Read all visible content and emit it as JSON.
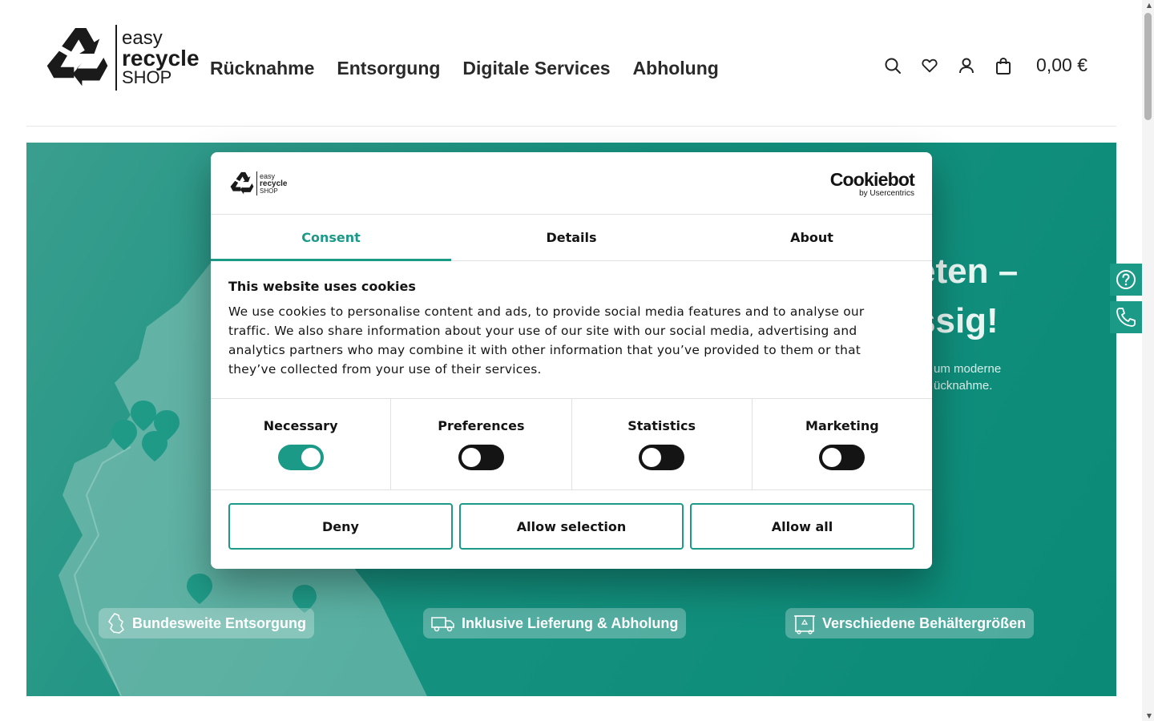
{
  "brand": {
    "line1": "easy",
    "line2": "recycle",
    "line3": "SHOP"
  },
  "nav": {
    "items": [
      "Rücknahme",
      "Entsorgung",
      "Digitale Services",
      "Abholung"
    ]
  },
  "header_tools": {
    "cart_total": "0,00 €",
    "icons": [
      "search-icon",
      "heart-icon",
      "user-icon",
      "shopping-bag-icon"
    ]
  },
  "hero": {
    "headline_line1": "eten –",
    "headline_line2": "ssig!",
    "sub_line1": "um moderne",
    "sub_line2": "ücknahme.",
    "features": [
      "Bundesweite Entsorgung",
      "Inklusive Lieferung & Abholung",
      "Verschiedene Behältergrößen"
    ]
  },
  "side_buttons": {
    "icons": [
      "help-question-icon",
      "phone-icon"
    ]
  },
  "cookie_modal": {
    "brand_line1": "easy",
    "brand_line2": "recycle",
    "brand_line3": "SHOP",
    "provider_name": "Cookiebot",
    "provider_sub": "by Usercentrics",
    "tabs": [
      "Consent",
      "Details",
      "About"
    ],
    "active_tab": "Consent",
    "title": "This website uses cookies",
    "text_lines": [
      "We use cookies to personalise content and ads, to provide social media features and to analyse our",
      "traffic. We also share information about your use of our site with our social media, advertising and",
      "analytics partners who may combine it with other information that you’ve provided to them or that",
      "they’ve collected from your use of their services."
    ],
    "toggles": [
      {
        "label": "Necessary",
        "on": true
      },
      {
        "label": "Preferences",
        "on": false
      },
      {
        "label": "Statistics",
        "on": false
      },
      {
        "label": "Marketing",
        "on": false
      }
    ],
    "buttons": {
      "deny": "Deny",
      "allow_selection": "Allow selection",
      "allow_all": "Allow all"
    },
    "accent_color": "#1c9a88"
  }
}
